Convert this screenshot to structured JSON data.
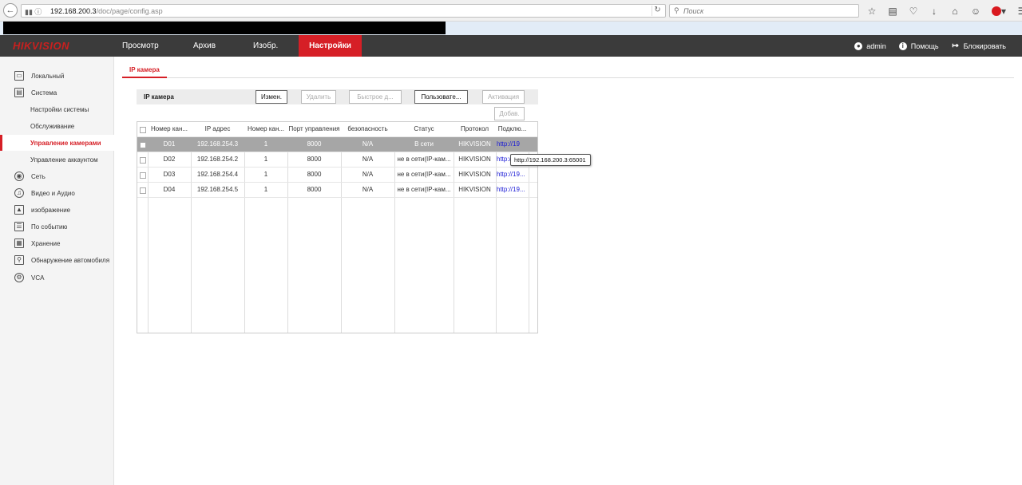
{
  "browser": {
    "url_host": "192.168.200.3",
    "url_path": "/doc/page/config.asp",
    "search_placeholder": "Поиск"
  },
  "app": {
    "logo_text": "HIKVISION",
    "nav": [
      "Просмотр",
      "Архив",
      "Изобр.",
      "Настройки"
    ],
    "header_right": {
      "user": "admin",
      "help": "Помощь",
      "lock": "Блокировать"
    }
  },
  "sidebar": {
    "items": [
      {
        "label": "Локальный",
        "icon": "monitor-icon"
      },
      {
        "label": "Система",
        "icon": "system-icon"
      },
      {
        "label": "Настройки системы"
      },
      {
        "label": "Обслуживание"
      },
      {
        "label": "Управление камерами"
      },
      {
        "label": "Управление аккаунтом"
      },
      {
        "label": "Сеть",
        "icon": "network-icon"
      },
      {
        "label": "Видео и Аудио",
        "icon": "video-audio-icon"
      },
      {
        "label": "изображение",
        "icon": "image-icon"
      },
      {
        "label": "По событию",
        "icon": "event-icon"
      },
      {
        "label": "Хранение",
        "icon": "storage-icon"
      },
      {
        "label": "Обнаружение автомобиля",
        "icon": "vehicle-icon"
      },
      {
        "label": "VCA",
        "icon": "vca-icon"
      }
    ]
  },
  "content": {
    "tab": "IP камера",
    "toolbar": {
      "title": "IP камера",
      "modify": "Измен.",
      "delete": "Удалить",
      "quick_add": "Быстрое д...",
      "custom": "Пользовате...",
      "activate": "Активация",
      "add": "Добав."
    },
    "table": {
      "headers": [
        "Номер кан...",
        "IP адрес",
        "Номер кан...",
        "Порт управления",
        "безопасность",
        "Статус",
        "Протокол",
        "Подклю..."
      ],
      "rows": [
        [
          "D01",
          "192.168.254.3",
          "1",
          "8000",
          "N/A",
          "В сети",
          "HIKVISION",
          "http://19"
        ],
        [
          "D02",
          "192.168.254.2",
          "1",
          "8000",
          "N/A",
          "не в сети(IP-кам...",
          "HIKVISION",
          "http:/"
        ],
        [
          "D03",
          "192.168.254.4",
          "1",
          "8000",
          "N/A",
          "не в сети(IP-кам...",
          "HIKVISION",
          "http://19..."
        ],
        [
          "D04",
          "192.168.254.5",
          "1",
          "8000",
          "N/A",
          "не в сети(IP-кам...",
          "HIKVISION",
          "http://19..."
        ]
      ]
    },
    "tooltip": "http://192.168.200.3:65001"
  }
}
